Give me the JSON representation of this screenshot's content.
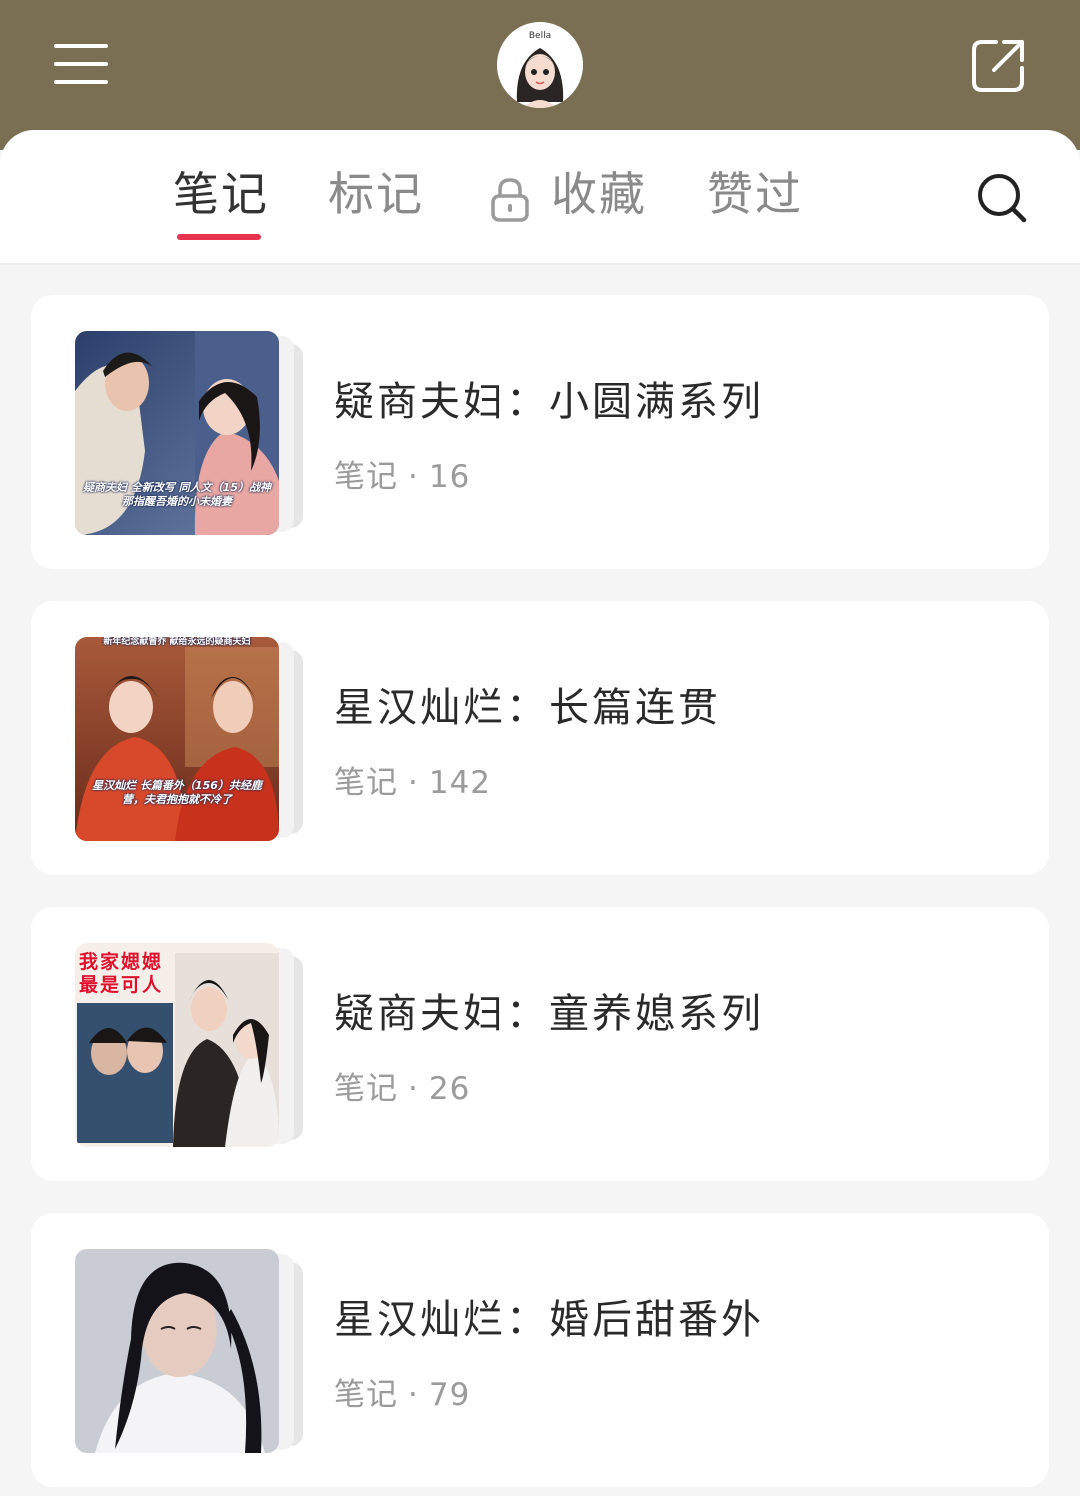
{
  "header": {
    "menu_icon": "menu-icon",
    "avatar_text": "Bella",
    "share_icon": "share-icon"
  },
  "tabs": [
    {
      "label": "笔记",
      "active": true
    },
    {
      "label": "标记",
      "active": false
    },
    {
      "label": "收藏",
      "active": false,
      "icon": "lock-icon"
    },
    {
      "label": "赞过",
      "active": false
    }
  ],
  "search_icon": "search-icon",
  "accent_color": "#e8334f",
  "header_color": "#7b6f53",
  "collections": [
    {
      "title": "疑商夫妇：小圆满系列",
      "meta_label": "笔记",
      "count": "16",
      "cover_caption": "疑商夫妇 全新改写 同人文（15）战神那指醒吾婚的小未婚妻"
    },
    {
      "title": "星汉灿烂：长篇连贯",
      "meta_label": "笔记",
      "count": "142",
      "cover_top": "新年纪念献曾乔 献给永远的疑商夫妇",
      "cover_caption": "星汉灿烂 长篇番外（156）共经鹿营，夫君抱抱就不冷了"
    },
    {
      "title": "疑商夫妇：童养媳系列",
      "meta_label": "笔记",
      "count": "26",
      "cover_overlay": "我家媤媤最是可人"
    },
    {
      "title": "星汉灿烂：婚后甜番外",
      "meta_label": "笔记",
      "count": "79"
    }
  ]
}
